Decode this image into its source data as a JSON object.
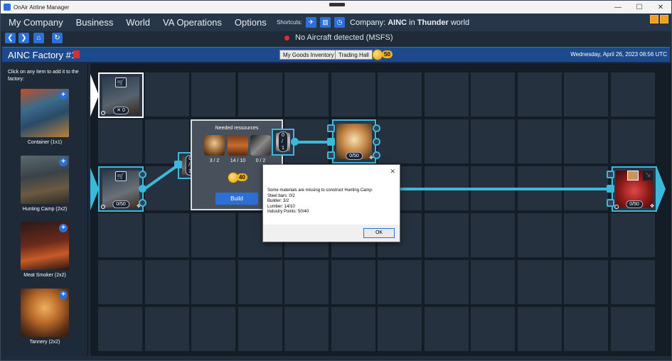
{
  "window": {
    "title": "OnAir Airline Manager",
    "minimize": "—",
    "maximize": "☐",
    "close": "✕"
  },
  "menu": {
    "items": [
      "My Company",
      "Business",
      "World",
      "VA Operations",
      "Options"
    ]
  },
  "shortcuts": {
    "label": "Shortcuts:",
    "company_prefix": "Company:",
    "company_name": "AINC",
    "in_text": "in",
    "world_name": "Thunder",
    "world_suffix": "world"
  },
  "status": {
    "text": "No Aircraft detected (MSFS)",
    "color": "#d63030"
  },
  "factory": {
    "title": "AINC Factory #1",
    "goods_inventory": "My Goods Inventory",
    "trading_hall": "Trading Hall",
    "points": "50",
    "datetime": "Wednesday, April 26, 2023 08:56 UTC"
  },
  "sidebar": {
    "hint": "Click on any item to add it to the factory:",
    "items": [
      {
        "label": "Container (1x1)",
        "icon": "container-icon"
      },
      {
        "label": "Hunting Camp (2x2)",
        "icon": "hunting-camp-icon"
      },
      {
        "label": "Meat Smoker (2x2)",
        "icon": "meat-smoker-icon"
      },
      {
        "label": "Tannery (2x2)",
        "icon": "tannery-icon"
      }
    ]
  },
  "nodes": {
    "container_top": {
      "count": "0",
      "icon": "cart-icon"
    },
    "container_left": {
      "count": "0/50",
      "icon": "cart-icon"
    },
    "gate_small": {
      "count": "0 / 3"
    },
    "pelt_top": {
      "count": "0 / 1"
    },
    "pelt_node": {
      "count": "0/50"
    },
    "meat_right": {
      "count": "0/50"
    }
  },
  "resources": {
    "title": "Needed ressources",
    "slots": [
      {
        "name": "builder",
        "count": "3 / 2"
      },
      {
        "name": "lumber",
        "count": "14 / 10"
      },
      {
        "name": "steel-bars",
        "count": "0 / 2"
      }
    ],
    "points": "40",
    "build_label": "Build"
  },
  "dialog": {
    "close": "✕",
    "lines": [
      "Some materials are missing to construct Hunting Camp:",
      "Steel bars: 0/2",
      "Builder: 3/2",
      "Lumber: 14/10",
      "Industry Points: 50/40"
    ],
    "ok_label": "OK"
  },
  "colors": {
    "accent": "#2c6fd6",
    "connector": "#3db8d8",
    "factory_bar": "#1d4a8c"
  }
}
